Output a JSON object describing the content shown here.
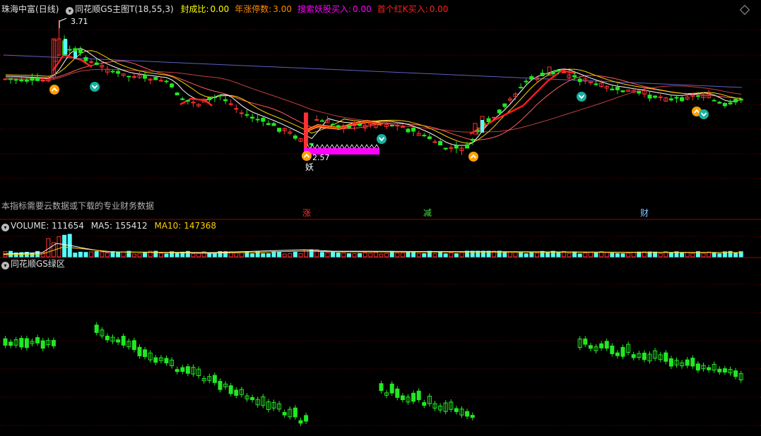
{
  "main_panel": {
    "stock_name": "珠海中富",
    "period": "(日线)",
    "indicator_name": "同花顺GS主图T(18,55,3)",
    "items": [
      {
        "label": "封成比:",
        "value": "0.00",
        "color": "#ffff00"
      },
      {
        "label": "年涨停数:",
        "value": "3.00",
        "color": "#ff8c00"
      },
      {
        "label": "搜索妖股买入:",
        "value": "0.00",
        "color": "#ff00ff"
      },
      {
        "label": "首个红K买入:",
        "value": "0.00",
        "color": "#ff2020"
      }
    ],
    "high_marker": "3.71",
    "low_marker": "2.57",
    "low_glyph": "妖",
    "note": "本指标需要云数据或下载的专业财务数据",
    "tags": [
      {
        "text": "涨",
        "color": "#ff3030"
      },
      {
        "text": "减",
        "color": "#40e040"
      },
      {
        "text": "财",
        "color": "#80c8ff"
      }
    ]
  },
  "volume_panel": {
    "label": "VOLUME:",
    "value": "111654",
    "ma5_label": "MA5:",
    "ma5": "155412",
    "ma10_label": "MA10:",
    "ma10": "147368"
  },
  "green_panel": {
    "title": "同花顺GS绿区"
  },
  "colors": {
    "up": "#ff3232",
    "down_fill": "#54ffff",
    "green": "#22e822",
    "grid": "#7a0000",
    "ma_white": "#ffffff",
    "ma_yellow": "#ffd000",
    "ma_pink": "#ff6060",
    "magenta": "#ff00ff"
  }
}
